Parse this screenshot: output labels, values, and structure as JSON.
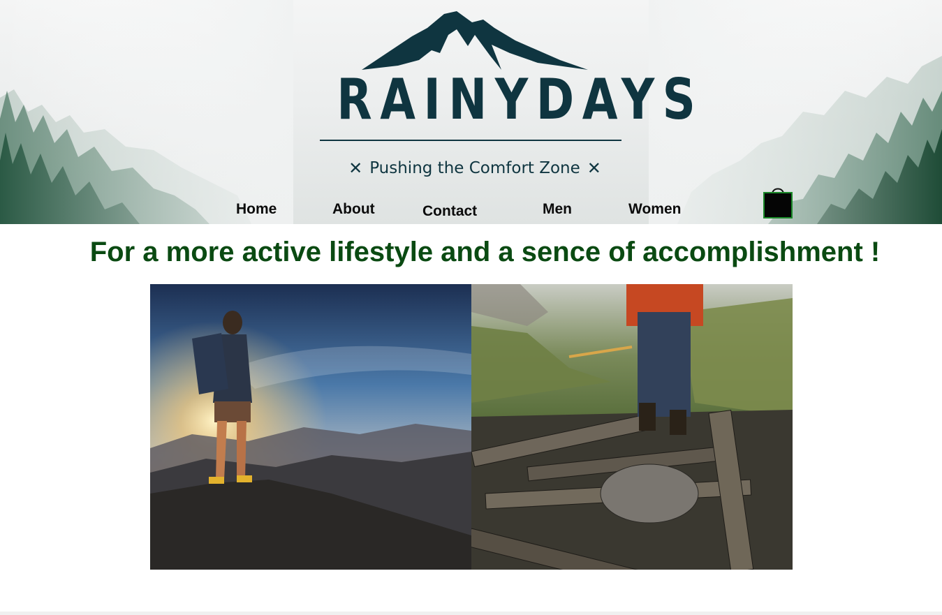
{
  "header": {
    "brand_name": "RAINYDAYS",
    "tagline": "Pushing the Comfort Zone",
    "colors": {
      "brand": "#0f3540",
      "forest": "#2d5a45"
    }
  },
  "nav": {
    "items": [
      {
        "label": "Home"
      },
      {
        "label": "About"
      },
      {
        "label": "Contact"
      },
      {
        "label": "Men"
      },
      {
        "label": "Women"
      }
    ],
    "cart_icon": "shopping-bag-icon"
  },
  "main": {
    "headline": "For a more active lifestyle and a sence of accomplishment !",
    "headline_color": "#0a4a12",
    "photos": [
      {
        "name": "hiker-on-summit-photo"
      },
      {
        "name": "hiker-on-log-bridge-photo"
      }
    ]
  }
}
